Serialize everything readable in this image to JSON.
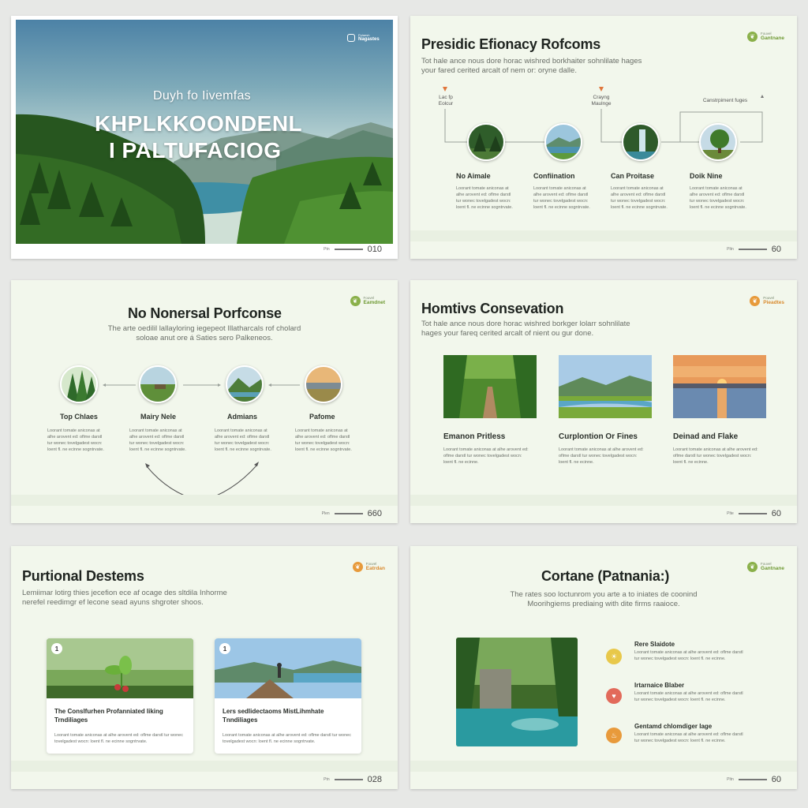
{
  "slides": {
    "s1": {
      "logo_top": "Polaesh",
      "logo_bottom": "Nagastes",
      "kicker": "Duyh fo Iivemfas",
      "line1": "KHPLKKOONDENL",
      "line2": "I PALTUFACIOG",
      "footer_small": "Ptn",
      "page": "010"
    },
    "s2": {
      "title": "Presidic Efionacy Rofcoms",
      "subtitle": "Tot hale ance nous dore horac wishred borkhaiter sohnlilate hages your fared cerited arcalt of nem or: oryne dalle.",
      "logo_top": "Fouvel",
      "logo_bottom": "Gantnane",
      "ticks": [
        "Lac fp Eolcur",
        "Crayng Maulnge",
        "Canstrpiment fuges"
      ],
      "items": [
        {
          "label": "No Aimale",
          "text": "Loorant tomate aniconas at alhe arovent ed: oflme darstl tur wonec tovelgadest wocn: loent fl. ne ecinne sogntrvate."
        },
        {
          "label": "Confiination",
          "text": "Loorant tomate aniconas at alhe arovent ed: oflme darstl tur wonec tovelgadest wocn: loent fl. ne ecinne sogntrvate."
        },
        {
          "label": "Can Proitase",
          "text": "Loorant tomate aniconas at alhe arovent ed: oflme darstl tur wonec tovelgadest wocn: loent fl. ne ecinne sogntrvate."
        },
        {
          "label": "Doik Nine",
          "text": "Loorant tomate aniconas at alhe arovent ed: oflme darstl tur wonec tovelgadest wocn: loent fl. ne ecinne sogntrvate."
        }
      ],
      "footer_small": "Pltn",
      "page": "60"
    },
    "s3": {
      "title": "No Nonersal Porfconse",
      "subtitle": "The arte oedilil lallayloring iegepeot Illatharcals rof cholard soloae anut ore á Saties sero Palkeneos.",
      "logo_top": "Fouvel",
      "logo_bottom": "Eamdnet",
      "items": [
        {
          "label": "Top Chlaes",
          "text": "Loorant tomate aniconas at alhe arovent ed: oflme darstl tur wonec tovelgadest wocn: loent fl. ne ecinne sogntrvate."
        },
        {
          "label": "Mairy Nele",
          "text": "Loorant tomate aniconas at alhe arovent ed: oflme darstl tur wonec tovelgadest wocn: loent fl. ne ecinne sogntrvate."
        },
        {
          "label": "Admians",
          "text": "Loorant tomate aniconas at alhe arovent ed: oflme darstl tur wonec tovelgadest wocn: loent fl. ne ecinne sogntrvate."
        },
        {
          "label": "Pafome",
          "text": "Loorant tomate aniconas at alhe arovent ed: oflme darstl tur wonec tovelgadest wocn: loent fl. ne ecinne sogntrvate."
        }
      ],
      "footer_small": "Plen",
      "page": "660"
    },
    "s4": {
      "title": "Homtivs Consevation",
      "subtitle": "Tot hale ance nous dore horac wishred borkger lolarr sohnlilate hages your fareq cerited arcalt of nient ou gur done.",
      "logo_top": "Pouvel",
      "logo_bottom": "Pieadtes",
      "items": [
        {
          "title": "Emanon Pritless",
          "text": "Loorant tomate aniconas at alhe arovent ed: oflme darstl tur wonec tovelgadest wocn: loent fl. ne ecinne."
        },
        {
          "title": "Curplontion Or Fines",
          "text": "Loorant tomate aniconas at alhe arovent ed: oflme darstl tur wonec tovelgadest wocn: loent fl. ne ecinne."
        },
        {
          "title": "Deinad and Flake",
          "text": "Loorant tomate aniconas at alhe arovent ed: oflme darstl tur wonec tovelgadest wocn: loent fl. ne ecinne."
        }
      ],
      "footer_small": "Plte",
      "page": "60"
    },
    "s5": {
      "title": "Purtional Destems",
      "subtitle": "Lemiimar lotirg thies jecefion ece af ocage des sltdila Inhorme nerefel reedimgr ef lecone sead ayuns shgroter shoos.",
      "logo_top": "Fouvel",
      "logo_bottom": "Eatrdan",
      "cards": [
        {
          "badge": "1",
          "title": "The Conslfurhen Profanniated Iiking Trndiliages",
          "text": "Loorant tomate aniconas at alhe arovent ed: oflme darstl tur wonec tovelgadest wocn: loent fl. ne ecinne sogntrvate."
        },
        {
          "badge": "1",
          "title": "Lers sedlidectaoms MistLihmhate Tnndiliages",
          "text": "Loorant tomate aniconas at alhe arovent ed: oflme darstl tur wonec tovelgadest wocn: loent fl. ne ecinne sogntrvate."
        }
      ],
      "footer_small": "Ptn",
      "page": "028"
    },
    "s6": {
      "title": "Cortane (Patnania:)",
      "subtitle": "The rates soo loctunrom you arte a to iniates de coonind Moorihgiems prediaing with dite firms raaioce.",
      "logo_top": "Fouvel",
      "logo_bottom": "Gantnane",
      "items": [
        {
          "title": "Rere Slaidote",
          "text": "Loorant tomate aniconas at alhe arovent ed: oflme darstl tur wonec tovelgadest wocn: loent fl. ne ecinne."
        },
        {
          "title": "Irtarnaice Blaber",
          "text": "Loorant tomate aniconas at alhe arovent ed: oflme darstl tur wonec tovelgadest wocn: loent fl. ne ecinne."
        },
        {
          "title": "Gentamd chlomdiger lage",
          "text": "Loorant tomate aniconas at alhe arovent ed: oflme darstl tur wonec tovelgadest wocn: loent fl. ne ecinne."
        }
      ],
      "footer_small": "Pltn",
      "page": "60"
    }
  },
  "icons": {
    "brand": "leaf-icon",
    "s6_list": [
      "sun-icon",
      "heart-icon",
      "flame-icon"
    ]
  },
  "colors": {
    "accent_green": "#6f9a34",
    "accent_orange": "#e79a3b",
    "slide_bg": "#f2f7ec"
  }
}
